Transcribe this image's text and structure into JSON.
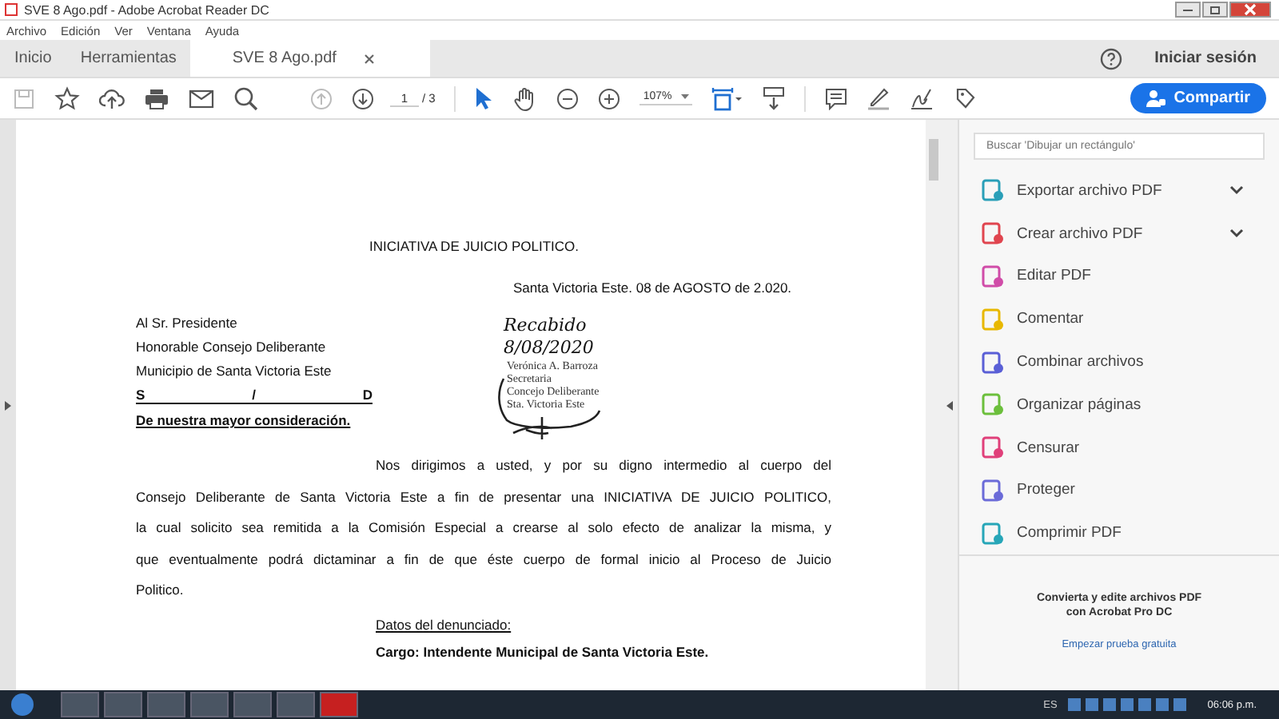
{
  "window": {
    "title": "SVE 8 Ago.pdf - Adobe Acrobat Reader DC"
  },
  "menu": [
    "Archivo",
    "Edición",
    "Ver",
    "Ventana",
    "Ayuda"
  ],
  "tabs": [
    {
      "label": "Inicio",
      "selected": false,
      "closable": false
    },
    {
      "label": "Herramientas",
      "selected": false,
      "closable": false
    },
    {
      "label": "SVE 8 Ago.pdf",
      "selected": true,
      "closable": true
    }
  ],
  "account": {
    "sign_in": "Iniciar sesión"
  },
  "toolbar": {
    "page": "1",
    "page_total": "/ 3",
    "zoom": "107%",
    "share": "Compartir"
  },
  "document": {
    "title": "INICIATIVA DE JUICIO POLITICO.",
    "date": "Santa Victoria Este. 08 de AGOSTO de 2.020.",
    "address": [
      "Al Sr. Presidente",
      "Honorable Consejo Deliberante",
      "Municipio de Santa Victoria Este"
    ],
    "sd_left": "S",
    "sd_mid": "/",
    "sd_right": "D",
    "salutation": "De nuestra mayor consideración.",
    "paragraph_lines": [
      "Nos dirigimos a usted, y por su digno intermedio al cuerpo del",
      "Consejo Deliberante de Santa Victoria Este a fin de presentar una INICIATIVA DE JUICIO POLITICO,",
      "la cual solicito sea remitida a la Comisión Especial a crearse al solo efecto de analizar la misma, y",
      "que eventualmente podrá dictaminar a fin de que éste cuerpo de formal inicio al Proceso de Juicio",
      "Politico."
    ],
    "section_heading": "Datos del denunciado:",
    "cargo": "Cargo: Intendente Municipal de Santa Victoria Este.",
    "stamp": {
      "handwritten": [
        "Recabido",
        "8/08/2020"
      ],
      "printed": [
        "Verónica A. Barroza",
        "Secretaria",
        "Concejo Deliberante",
        "Sta. Victoria Este"
      ]
    }
  },
  "tools_panel": {
    "search_placeholder": "Buscar 'Dibujar un rectángulo'",
    "tools": [
      {
        "label": "Exportar archivo PDF",
        "color": "#2a9fb8",
        "expandable": true
      },
      {
        "label": "Crear archivo PDF",
        "color": "#e0454f",
        "expandable": true
      },
      {
        "label": "Editar PDF",
        "color": "#d04ca8",
        "expandable": false
      },
      {
        "label": "Comentar",
        "color": "#e8b800",
        "expandable": false
      },
      {
        "label": "Combinar archivos",
        "color": "#5a5fd6",
        "expandable": false
      },
      {
        "label": "Organizar páginas",
        "color": "#6cbf3c",
        "expandable": false
      },
      {
        "label": "Censurar",
        "color": "#e0407a",
        "expandable": false
      },
      {
        "label": "Proteger",
        "color": "#6b6bd8",
        "expandable": false
      },
      {
        "label": "Comprimir PDF",
        "color": "#27a6b8",
        "expandable": false
      }
    ],
    "promo": [
      "Convierta y edite archivos PDF",
      "con Acrobat Pro DC"
    ],
    "promo_link": "Empezar prueba gratuita"
  },
  "taskbar": {
    "language": "ES",
    "clock": "06:06 p.m."
  }
}
